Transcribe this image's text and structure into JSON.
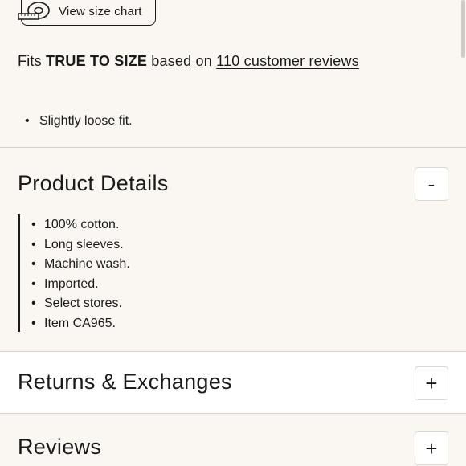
{
  "size_chart": {
    "label": "View size chart",
    "icon": "measuring-tape-icon"
  },
  "fit": {
    "prefix": "Fits",
    "rating": "TRUE TO SIZE",
    "middle": "based on",
    "reviews_link": "110 customer reviews",
    "notes": [
      "Slightly loose fit."
    ]
  },
  "product_details": {
    "title": "Product Details",
    "toggle": "-",
    "items": [
      "100% cotton.",
      "Long sleeves.",
      "Machine wash.",
      "Imported.",
      "Select stores.",
      "Item CA965."
    ]
  },
  "returns": {
    "title": "Returns & Exchanges",
    "toggle": "+"
  },
  "reviews": {
    "title": "Reviews",
    "toggle": "+"
  },
  "colors": {
    "background": "#faf6f2",
    "band": "#ffffff",
    "text": "#1a1a1a",
    "divider": "#d6d1cc"
  }
}
